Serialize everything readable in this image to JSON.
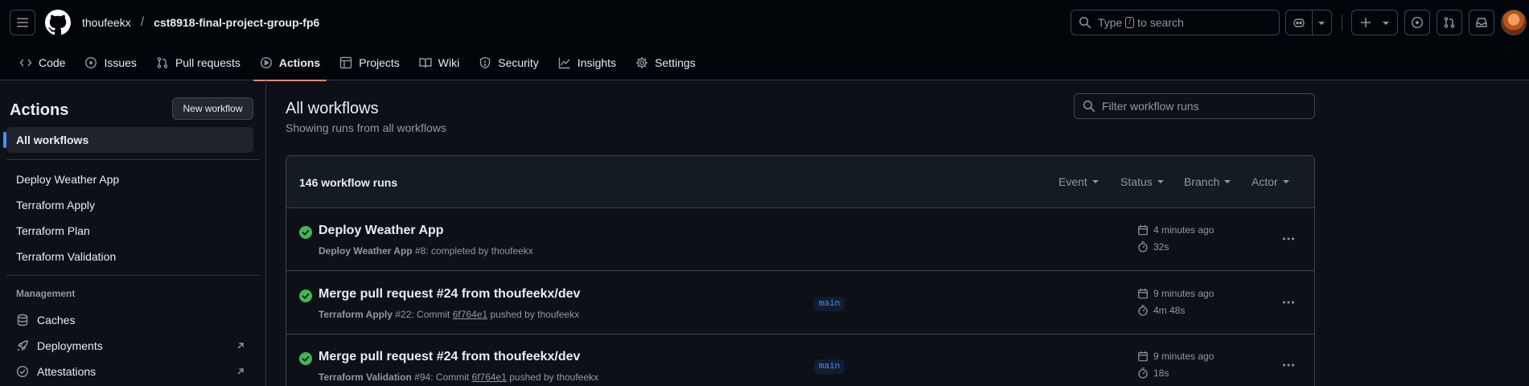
{
  "header": {
    "owner": "thoufeekx",
    "separator": "/",
    "repo": "cst8918-final-project-group-fp6",
    "search": {
      "prefix": "Type",
      "key": "/",
      "suffix": "to search"
    }
  },
  "tabs": [
    {
      "label": "Code",
      "icon": "code-icon"
    },
    {
      "label": "Issues",
      "icon": "issue-icon"
    },
    {
      "label": "Pull requests",
      "icon": "pull-request-icon"
    },
    {
      "label": "Actions",
      "icon": "play-icon",
      "active": true
    },
    {
      "label": "Projects",
      "icon": "table-icon"
    },
    {
      "label": "Wiki",
      "icon": "book-icon"
    },
    {
      "label": "Security",
      "icon": "shield-icon"
    },
    {
      "label": "Insights",
      "icon": "graph-icon"
    },
    {
      "label": "Settings",
      "icon": "gear-icon"
    }
  ],
  "sidebar": {
    "title": "Actions",
    "new_workflow": "New workflow",
    "all_workflows": "All workflows",
    "workflows": [
      "Deploy Weather App",
      "Terraform Apply",
      "Terraform Plan",
      "Terraform Validation"
    ],
    "management_title": "Management",
    "management": [
      {
        "label": "Caches",
        "icon": "database-icon"
      },
      {
        "label": "Deployments",
        "icon": "rocket-icon",
        "external": true
      },
      {
        "label": "Attestations",
        "icon": "verified-icon",
        "external": true
      }
    ]
  },
  "main": {
    "title": "All workflows",
    "subtitle": "Showing runs from all workflows",
    "filter_placeholder": "Filter workflow runs",
    "run_count": "146 workflow runs",
    "filters": [
      "Event",
      "Status",
      "Branch",
      "Actor"
    ],
    "runs": [
      {
        "title": "Deploy Weather App",
        "workflow": "Deploy Weather App",
        "number": "#8",
        "detail": ": completed by thoufeekx",
        "branch": "",
        "when": "4 minutes ago",
        "duration": "32s",
        "status": "success"
      },
      {
        "title": "Merge pull request #24 from thoufeekx/dev",
        "workflow": "Terraform Apply",
        "number": "#22",
        "commit_prefix": ": Commit ",
        "sha": "6f764e1",
        "pushed_by": " pushed by thoufeekx",
        "branch": "main",
        "when": "9 minutes ago",
        "duration": "4m 48s",
        "status": "success"
      },
      {
        "title": "Merge pull request #24 from thoufeekx/dev",
        "workflow": "Terraform Validation",
        "number": "#94",
        "commit_prefix": ": Commit ",
        "sha": "6f764e1",
        "pushed_by": " pushed by thoufeekx",
        "branch": "main",
        "when": "9 minutes ago",
        "duration": "18s",
        "status": "success"
      }
    ]
  },
  "colors": {
    "accent": "#4493f8",
    "success": "#3fb950",
    "tab_underline": "#f78166"
  }
}
